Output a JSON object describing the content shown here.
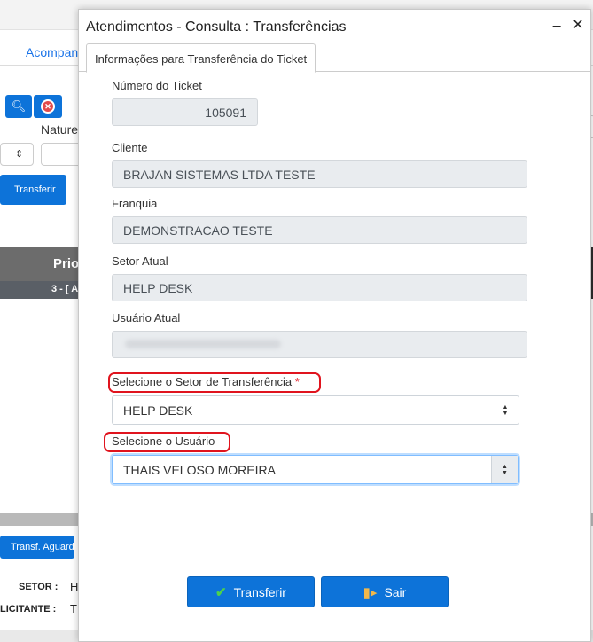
{
  "background": {
    "tab_label": "Acompan",
    "natureza_label": "Nature",
    "transfer_btn": "Transferir",
    "priority_header": "Prio",
    "priority_sub": "3 - [ A",
    "transf_aguard_btn": "Transf. Aguard",
    "setor_label": "SETOR :",
    "setor_value": "H",
    "solicitante_label": "LICITANTE :",
    "solicitante_value": "T"
  },
  "dialog": {
    "title": "Atendimentos - Consulta : Transferências",
    "tab": "Informações para Transferência do Ticket",
    "ticket_label": "Número do Ticket",
    "ticket_value": "105091",
    "cliente_label": "Cliente",
    "cliente_value": "BRAJAN SISTEMAS LTDA TESTE",
    "franquia_label": "Franquia",
    "franquia_value": "DEMONSTRACAO TESTE",
    "setor_atual_label": "Setor Atual",
    "setor_atual_value": "HELP DESK",
    "usuario_atual_label": "Usuário Atual",
    "setor_transfer_label": "Selecione o Setor de Transferência",
    "required_mark": "*",
    "setor_transfer_value": "HELP DESK",
    "usuario_label": "Selecione o Usuário",
    "usuario_value": "THAIS VELOSO MOREIRA",
    "transferir_btn": "Transferir",
    "sair_btn": "Sair"
  }
}
